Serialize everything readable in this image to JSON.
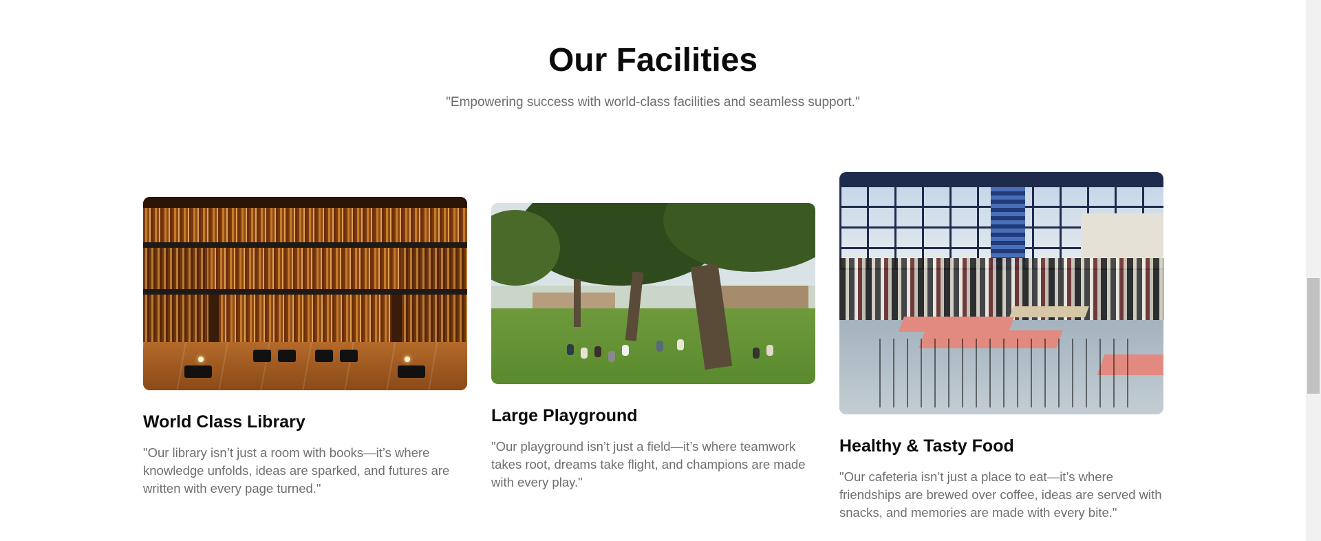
{
  "section": {
    "title": "Our Facilities",
    "subtitle": "\"Empowering success with world-class facilities and seamless support.\""
  },
  "cards": [
    {
      "title": "World Class Library",
      "text": "\"Our library isn’t just a room with books—it’s where knowledge unfolds, ideas are sparked, and futures are written with every page turned.\""
    },
    {
      "title": "Large Playground",
      "text": "\"Our playground isn’t just a field—it’s where teamwork takes root, dreams take flight, and champions are made with every play.\""
    },
    {
      "title": "Healthy & Tasty Food",
      "text": "\"Our cafeteria isn’t just a place to eat—it’s where friendships are brewed over coffee, ideas are served with snacks, and memories are made with every bite.\""
    }
  ],
  "colors": {
    "heading": "#0b0b0b",
    "body_text": "#6f6f6f",
    "background": "#ffffff"
  }
}
